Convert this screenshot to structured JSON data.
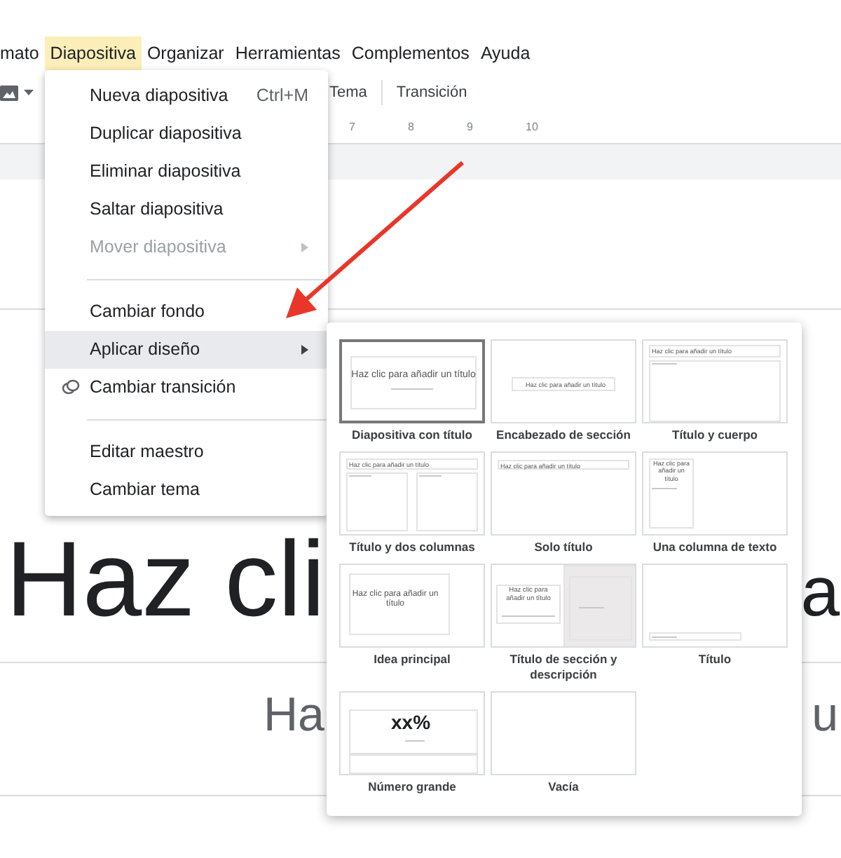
{
  "menu_bar": [
    {
      "label": "mato",
      "selected": false
    },
    {
      "label": "Diapositiva",
      "selected": true
    },
    {
      "label": "Organizar",
      "selected": false
    },
    {
      "label": "Herramientas",
      "selected": false
    },
    {
      "label": "Complementos",
      "selected": false
    },
    {
      "label": "Ayuda",
      "selected": false
    }
  ],
  "toolbar": {
    "buttons": [
      "Tema",
      "Transición"
    ]
  },
  "ruler": [
    "7",
    "8",
    "9",
    "10"
  ],
  "slide": {
    "title_left": "Haz cli",
    "title_right": "a",
    "subtitle_left": "Ha",
    "subtitle_right": "u"
  },
  "menu": [
    {
      "kind": "item",
      "label": "Nueva diapositiva",
      "shortcut": "Ctrl+M",
      "disabled": false,
      "highlighted": false,
      "submenu": false
    },
    {
      "kind": "item",
      "label": "Duplicar diapositiva",
      "disabled": false,
      "highlighted": false,
      "submenu": false
    },
    {
      "kind": "item",
      "label": "Eliminar diapositiva",
      "disabled": false,
      "highlighted": false,
      "submenu": false
    },
    {
      "kind": "item",
      "label": "Saltar diapositiva",
      "disabled": false,
      "highlighted": false,
      "submenu": false
    },
    {
      "kind": "item",
      "label": "Mover diapositiva",
      "disabled": true,
      "highlighted": false,
      "submenu": true
    },
    {
      "kind": "separator"
    },
    {
      "kind": "item",
      "label": "Cambiar fondo",
      "disabled": false,
      "highlighted": false,
      "submenu": false
    },
    {
      "kind": "item",
      "label": "Aplicar diseño",
      "disabled": false,
      "highlighted": true,
      "submenu": true
    },
    {
      "kind": "icon_item",
      "label": "Cambiar transición",
      "disabled": false,
      "highlighted": false,
      "submenu": false
    },
    {
      "kind": "separator"
    },
    {
      "kind": "item",
      "label": "Editar maestro",
      "disabled": false,
      "highlighted": false,
      "submenu": false
    },
    {
      "kind": "item",
      "label": "Cambiar tema",
      "disabled": false,
      "highlighted": false,
      "submenu": false
    }
  ],
  "layouts": [
    {
      "kind": "title_slide",
      "label": "Diapositiva con título",
      "title_text": "Haz clic para añadir un título",
      "selected": true
    },
    {
      "kind": "section_header",
      "label": "Encabezado de sección",
      "title_text": "Haz clic para añadir un título",
      "selected": false
    },
    {
      "kind": "title_body",
      "label": "Título y cuerpo",
      "title_text": "Haz clic para añadir un título",
      "selected": false
    },
    {
      "kind": "two_columns",
      "label": "Título y dos columnas",
      "title_text": "Haz clic para añadir un título",
      "selected": false
    },
    {
      "kind": "title_only",
      "label": "Solo título",
      "title_text": "Haz clic para añadir un título",
      "selected": false
    },
    {
      "kind": "one_column",
      "label": "Una columna de texto",
      "title_text": "Haz clic para añadir un título",
      "selected": false
    },
    {
      "kind": "main_point",
      "label": "Idea principal",
      "title_text": "Haz clic para añadir un título",
      "selected": false
    },
    {
      "kind": "section_description",
      "label": "Título de sección y descripción",
      "title_text": "Haz clic para añadir un título",
      "selected": false
    },
    {
      "kind": "caption",
      "label": "Título",
      "selected": false
    },
    {
      "kind": "big_number",
      "label": "Número grande",
      "title_text": "xx%",
      "selected": false
    },
    {
      "kind": "blank",
      "label": "Vacía",
      "selected": false
    }
  ]
}
